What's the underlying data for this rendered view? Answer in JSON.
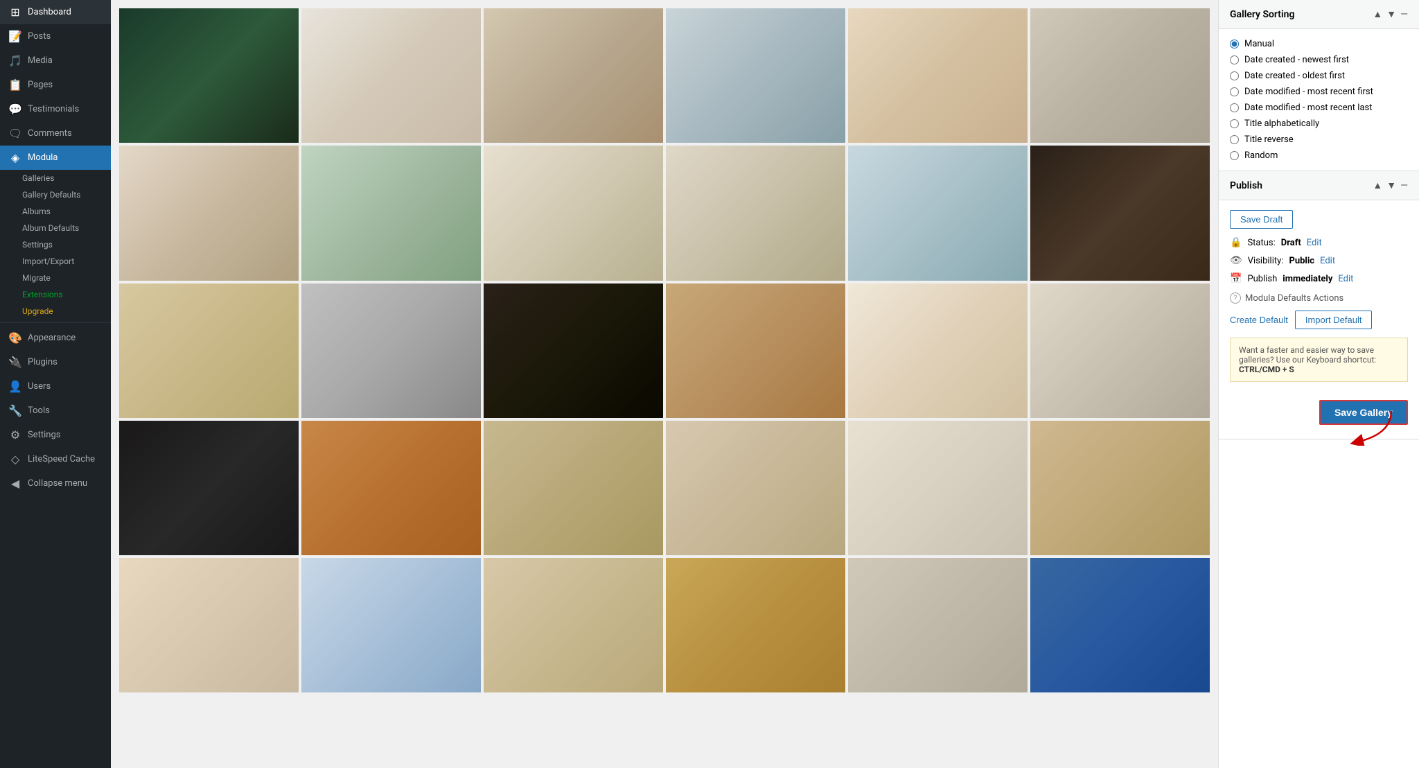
{
  "sidebar": {
    "items": [
      {
        "id": "dashboard",
        "label": "Dashboard",
        "icon": "⊞"
      },
      {
        "id": "posts",
        "label": "Posts",
        "icon": "📄"
      },
      {
        "id": "media",
        "label": "Media",
        "icon": "🎵"
      },
      {
        "id": "pages",
        "label": "Pages",
        "icon": "📋"
      },
      {
        "id": "testimonials",
        "label": "Testimonials",
        "icon": "💬"
      },
      {
        "id": "comments",
        "label": "Comments",
        "icon": "🗨"
      },
      {
        "id": "modula",
        "label": "Modula",
        "icon": "◈",
        "active": true
      }
    ],
    "modula_sub": [
      {
        "id": "galleries",
        "label": "Galleries"
      },
      {
        "id": "gallery-defaults",
        "label": "Gallery Defaults"
      },
      {
        "id": "albums",
        "label": "Albums"
      },
      {
        "id": "album-defaults",
        "label": "Album Defaults"
      },
      {
        "id": "settings",
        "label": "Settings"
      },
      {
        "id": "import-export",
        "label": "Import/Export"
      },
      {
        "id": "migrate",
        "label": "Migrate"
      },
      {
        "id": "extensions",
        "label": "Extensions",
        "green": true
      },
      {
        "id": "upgrade",
        "label": "Upgrade",
        "yellow": true
      }
    ],
    "bottom_items": [
      {
        "id": "appearance",
        "label": "Appearance",
        "icon": "🎨"
      },
      {
        "id": "plugins",
        "label": "Plugins",
        "icon": "🔌"
      },
      {
        "id": "users",
        "label": "Users",
        "icon": "👤"
      },
      {
        "id": "tools",
        "label": "Tools",
        "icon": "🔧"
      },
      {
        "id": "settings",
        "label": "Settings",
        "icon": "⚙"
      },
      {
        "id": "litespeed-cache",
        "label": "LiteSpeed Cache",
        "icon": "◇"
      },
      {
        "id": "collapse-menu",
        "label": "Collapse menu",
        "icon": "◀"
      }
    ]
  },
  "gallery_sorting": {
    "title": "Gallery Sorting",
    "options": [
      {
        "id": "manual",
        "label": "Manual",
        "selected": true
      },
      {
        "id": "date-newest",
        "label": "Date created - newest first",
        "selected": false
      },
      {
        "id": "date-oldest",
        "label": "Date created - oldest first",
        "selected": false
      },
      {
        "id": "date-modified-recent",
        "label": "Date modified - most recent first",
        "selected": false
      },
      {
        "id": "date-modified-last",
        "label": "Date modified - most recent last",
        "selected": false
      },
      {
        "id": "title-alpha",
        "label": "Title alphabetically",
        "selected": false
      },
      {
        "id": "title-reverse",
        "label": "Title reverse",
        "selected": false
      },
      {
        "id": "random",
        "label": "Random",
        "selected": false
      }
    ]
  },
  "publish": {
    "title": "Publish",
    "save_draft_label": "Save Draft",
    "status_label": "Status:",
    "status_value": "Draft",
    "status_edit": "Edit",
    "visibility_label": "Visibility:",
    "visibility_value": "Public",
    "visibility_edit": "Edit",
    "publish_label": "Publish",
    "publish_value": "immediately",
    "publish_edit": "Edit",
    "modula_defaults_label": "Modula Defaults Actions",
    "create_default_label": "Create Default",
    "import_default_label": "Import Default",
    "keyboard_shortcut_text": "Want a faster and easier way to save galleries? Use our Keyboard shortcut:",
    "keyboard_shortcut_keys": "CTRL/CMD + S",
    "save_gallery_label": "Save Gallery"
  },
  "gallery": {
    "images": [
      {
        "id": 1,
        "class": "img-1"
      },
      {
        "id": 2,
        "class": "img-2"
      },
      {
        "id": 3,
        "class": "img-3"
      },
      {
        "id": 4,
        "class": "img-4"
      },
      {
        "id": 5,
        "class": "img-5"
      },
      {
        "id": 6,
        "class": "img-6"
      },
      {
        "id": 7,
        "class": "img-7"
      },
      {
        "id": 8,
        "class": "img-8"
      },
      {
        "id": 9,
        "class": "img-9"
      },
      {
        "id": 10,
        "class": "img-10"
      },
      {
        "id": 11,
        "class": "img-11"
      },
      {
        "id": 12,
        "class": "img-12"
      },
      {
        "id": 13,
        "class": "img-13"
      },
      {
        "id": 14,
        "class": "img-14"
      },
      {
        "id": 15,
        "class": "img-15"
      },
      {
        "id": 16,
        "class": "img-16"
      },
      {
        "id": 17,
        "class": "img-17"
      },
      {
        "id": 18,
        "class": "img-18"
      },
      {
        "id": 19,
        "class": "img-19"
      },
      {
        "id": 20,
        "class": "img-20"
      },
      {
        "id": 21,
        "class": "img-21"
      },
      {
        "id": 22,
        "class": "img-22"
      },
      {
        "id": 23,
        "class": "img-23"
      },
      {
        "id": 24,
        "class": "img-24"
      },
      {
        "id": 25,
        "class": "img-25"
      },
      {
        "id": 26,
        "class": "img-26"
      },
      {
        "id": 27,
        "class": "img-27"
      },
      {
        "id": 28,
        "class": "img-28"
      },
      {
        "id": 29,
        "class": "img-29"
      },
      {
        "id": 30,
        "class": "img-30"
      }
    ]
  }
}
